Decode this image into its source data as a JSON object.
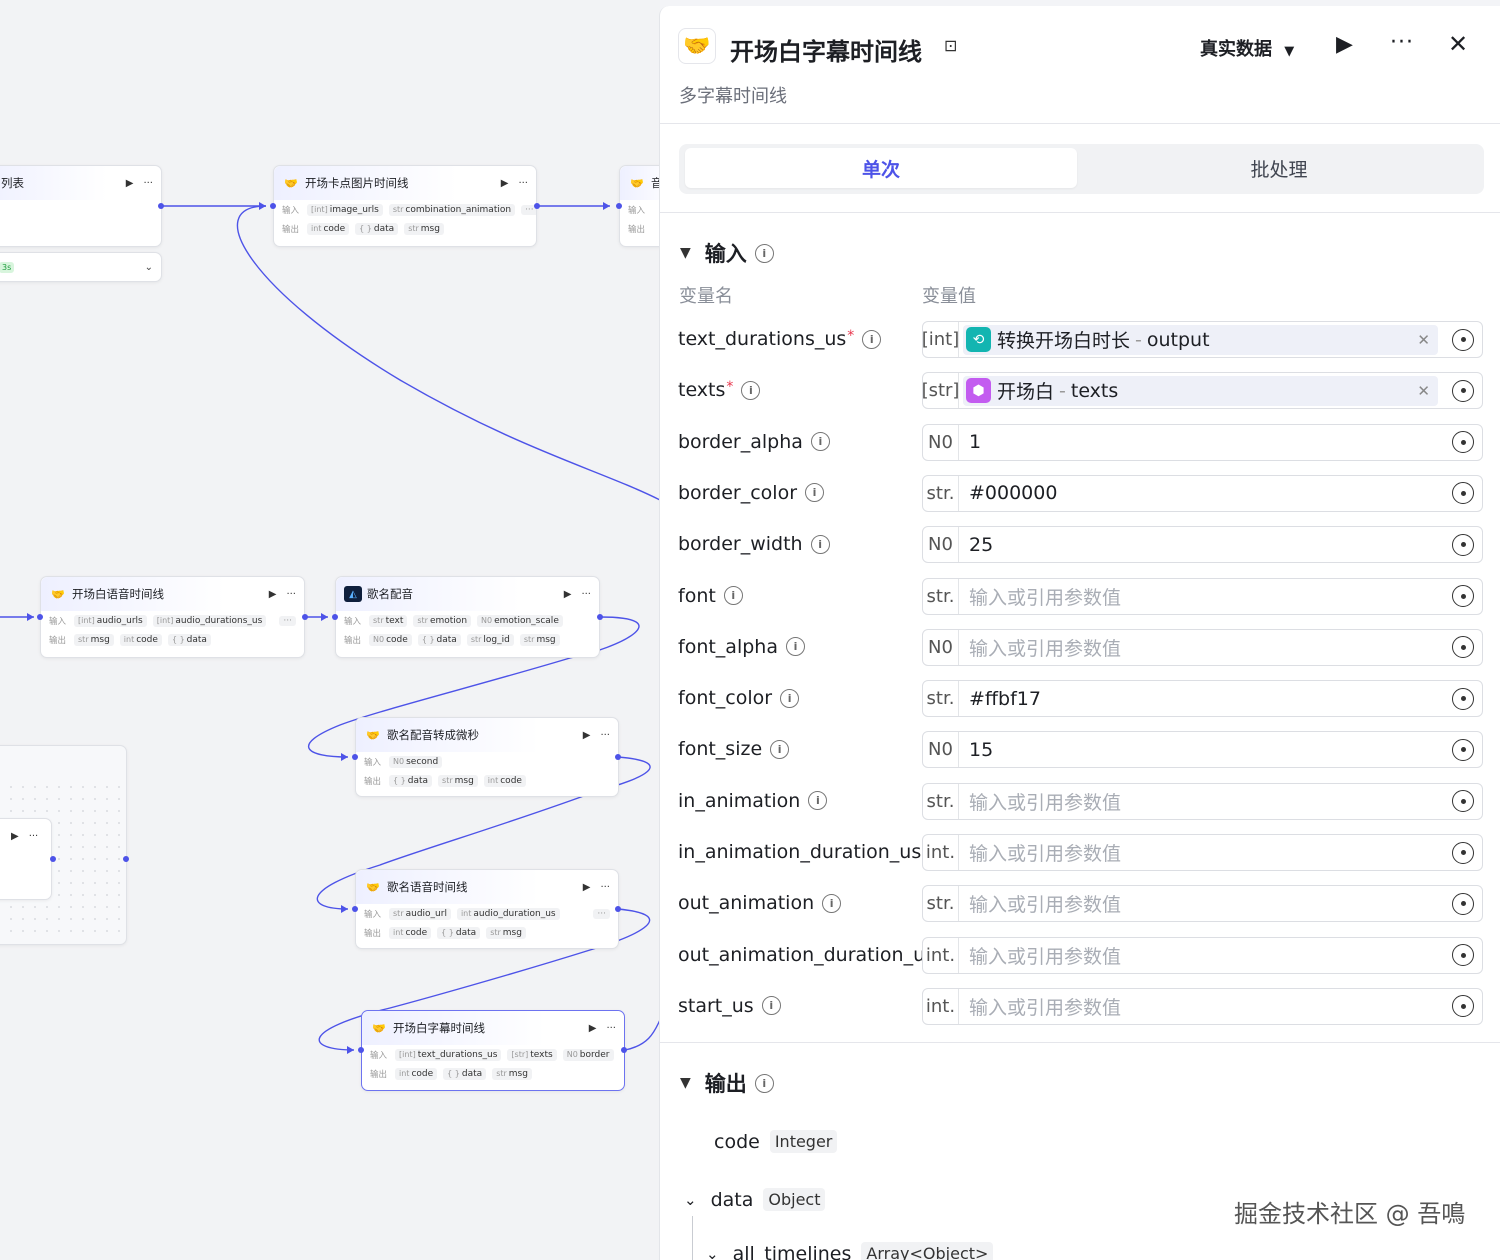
{
  "canvas": {
    "node_a": {
      "title": "列表",
      "badge": "3s"
    },
    "node_b": {
      "title": "开场卡点图片时间线",
      "in_label": "输入",
      "out_label": "输出",
      "inputs": [
        {
          "t": "[int]",
          "n": "image_urls"
        },
        {
          "t": "str",
          "n": "combination_animation"
        }
      ],
      "outputs": [
        {
          "t": "int",
          "n": "code"
        },
        {
          "t": "{ }",
          "n": "data"
        },
        {
          "t": "str",
          "n": "msg"
        }
      ]
    },
    "node_c": {
      "title": "音"
    },
    "node_d": {
      "title": "开场白语音时间线",
      "in_label": "输入",
      "out_label": "输出",
      "inputs": [
        {
          "t": "[int]",
          "n": "audio_urls"
        },
        {
          "t": "[int]",
          "n": "audio_durations_us"
        }
      ],
      "outputs": [
        {
          "t": "str",
          "n": "msg"
        },
        {
          "t": "int",
          "n": "code"
        },
        {
          "t": "{ }",
          "n": "data"
        }
      ]
    },
    "node_e": {
      "title": "歌名配音",
      "in_label": "输入",
      "out_label": "输出",
      "inputs": [
        {
          "t": "str",
          "n": "text"
        },
        {
          "t": "str",
          "n": "emotion"
        },
        {
          "t": "N0",
          "n": "emotion_scale"
        }
      ],
      "outputs": [
        {
          "t": "N0",
          "n": "code"
        },
        {
          "t": "{ }",
          "n": "data"
        },
        {
          "t": "str",
          "n": "log_id"
        },
        {
          "t": "str",
          "n": "msg"
        }
      ]
    },
    "node_f": {
      "title": "歌名配音转成微秒",
      "in_label": "输入",
      "out_label": "输出",
      "inputs": [
        {
          "t": "N0",
          "n": "second"
        }
      ],
      "outputs": [
        {
          "t": "{ }",
          "n": "data"
        },
        {
          "t": "str",
          "n": "msg"
        },
        {
          "t": "int",
          "n": "code"
        }
      ]
    },
    "node_g": {
      "title": "歌名语音时间线",
      "in_label": "输入",
      "out_label": "输出",
      "inputs": [
        {
          "t": "str",
          "n": "audio_url"
        },
        {
          "t": "int",
          "n": "audio_duration_us"
        }
      ],
      "outputs": [
        {
          "t": "int",
          "n": "code"
        },
        {
          "t": "{ }",
          "n": "data"
        },
        {
          "t": "str",
          "n": "msg"
        }
      ]
    },
    "node_h": {
      "title": "开场白字幕时间线",
      "in_label": "输入",
      "out_label": "输出",
      "inputs": [
        {
          "t": "[int]",
          "n": "text_durations_us"
        },
        {
          "t": "[str]",
          "n": "texts"
        },
        {
          "t": "N0",
          "n": "border"
        }
      ],
      "outputs": [
        {
          "t": "int",
          "n": "code"
        },
        {
          "t": "{ }",
          "n": "data"
        },
        {
          "t": "str",
          "n": "msg"
        }
      ]
    }
  },
  "panel": {
    "title": "开场白字幕时间线",
    "description": "多字幕时间线",
    "data_select": "真实数据",
    "tabs": [
      "单次",
      "批处理"
    ],
    "input_section": "输入",
    "col_name": "变量名",
    "col_value": "变量值",
    "params": [
      {
        "name": "text_durations_us",
        "required": true,
        "type": "[int]",
        "ref": {
          "node": "转换开场白时长",
          "var": "output",
          "color": "#13b5b1",
          "icon": "⟲"
        }
      },
      {
        "name": "texts",
        "required": true,
        "type": "[str]",
        "ref": {
          "node": "开场白",
          "var": "texts",
          "color": "#c35cf0",
          "icon": "⬢"
        }
      },
      {
        "name": "border_alpha",
        "type": "N0",
        "value": "1"
      },
      {
        "name": "border_color",
        "type": "str.",
        "value": "#000000"
      },
      {
        "name": "border_width",
        "type": "N0",
        "value": "25"
      },
      {
        "name": "font",
        "type": "str.",
        "placeholder": "输入或引用参数值"
      },
      {
        "name": "font_alpha",
        "type": "N0",
        "placeholder": "输入或引用参数值"
      },
      {
        "name": "font_color",
        "type": "str.",
        "value": "#ffbf17"
      },
      {
        "name": "font_size",
        "type": "N0",
        "value": "15"
      },
      {
        "name": "in_animation",
        "type": "str.",
        "placeholder": "输入或引用参数值"
      },
      {
        "name": "in_animation_duration_us",
        "type": "int.",
        "placeholder": "输入或引用参数值"
      },
      {
        "name": "out_animation",
        "type": "str.",
        "placeholder": "输入或引用参数值"
      },
      {
        "name": "out_animation_duration_us",
        "type": "int.",
        "placeholder": "输入或引用参数值"
      },
      {
        "name": "start_us",
        "type": "int.",
        "placeholder": "输入或引用参数值"
      }
    ],
    "output_section": "输出",
    "outputs": [
      {
        "name": "code",
        "type": "Integer"
      },
      {
        "name": "data",
        "type": "Object"
      },
      {
        "name": "all_timelines",
        "type": "Array<Object>"
      }
    ]
  },
  "watermark": "掘金技术社区 @ 吾鳴",
  "colors": {
    "accent": "#4d53e8",
    "required": "#e8364d"
  }
}
